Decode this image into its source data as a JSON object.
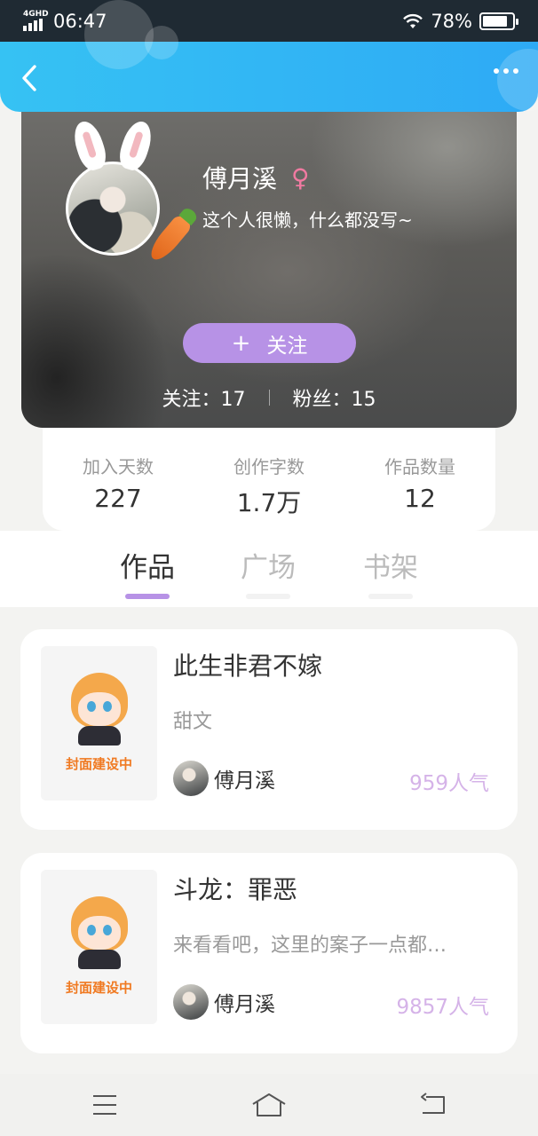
{
  "status_bar": {
    "network": "4GHD",
    "time": "06:47",
    "battery": "78%"
  },
  "header": {
    "back_icon": "chevron-left-icon",
    "more_icon": "more-dots-icon"
  },
  "profile": {
    "name": "傅月溪",
    "gender_symbol": "♀",
    "bio": "这个人很懒，什么都没写~",
    "follow_button": {
      "plus": "+",
      "label": "关注"
    },
    "following_label": "关注：",
    "following_count": "17",
    "fans_label": "粉丝：",
    "fans_count": "15"
  },
  "stats": [
    {
      "label": "加入天数",
      "value": "227"
    },
    {
      "label": "创作字数",
      "value": "1.7万"
    },
    {
      "label": "作品数量",
      "value": "12"
    }
  ],
  "tabs": [
    {
      "label": "作品",
      "active": true
    },
    {
      "label": "广场",
      "active": false
    },
    {
      "label": "书架",
      "active": false
    }
  ],
  "works": [
    {
      "cover_text": "封面建设中",
      "title": "此生非君不嫁",
      "desc": "甜文",
      "author": "傅月溪",
      "popularity": "959人气"
    },
    {
      "cover_text": "封面建设中",
      "title": "斗龙：罪恶",
      "desc": "来看看吧，这里的案子一点都…",
      "author": "傅月溪",
      "popularity": "9857人气"
    }
  ],
  "nav_bar": {
    "menu_icon": "menu-icon",
    "home_icon": "home-icon",
    "back_icon": "return-icon"
  },
  "colors": {
    "accent": "#b792e6",
    "header": "#2eaaf5",
    "popularity": "#d5b3e8",
    "gender": "#f07aa1"
  }
}
